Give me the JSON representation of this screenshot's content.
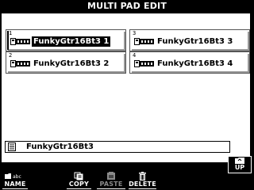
{
  "title": "MULTI PAD EDIT",
  "pads": [
    {
      "number": "1",
      "name": "FunkyGtr16Bt3 1",
      "selected": true
    },
    {
      "number": "2",
      "name": "FunkyGtr16Bt3 2",
      "selected": false
    },
    {
      "number": "3",
      "name": "FunkyGtr16Bt3 3",
      "selected": false
    },
    {
      "number": "4",
      "name": "FunkyGtr16Bt3 4",
      "selected": false
    }
  ],
  "bank": {
    "name": "FunkyGtr16Bt3",
    "icon": "document-icon"
  },
  "up_button": {
    "label": "UP",
    "icon": "folder-icon"
  },
  "softkeys": [
    {
      "label": "NAME",
      "icon": "name-icon",
      "enabled": true,
      "icon_text": "abc"
    },
    {
      "label": "COPY",
      "icon": "copy-icon",
      "enabled": true
    },
    {
      "label": "PASTE",
      "icon": "paste-icon",
      "enabled": false
    },
    {
      "label": "DELETE",
      "icon": "trash-icon",
      "enabled": true
    }
  ],
  "colors": {
    "background": "#000000",
    "panel": "#ffffff",
    "disabled_text": "#8a8a8a"
  }
}
